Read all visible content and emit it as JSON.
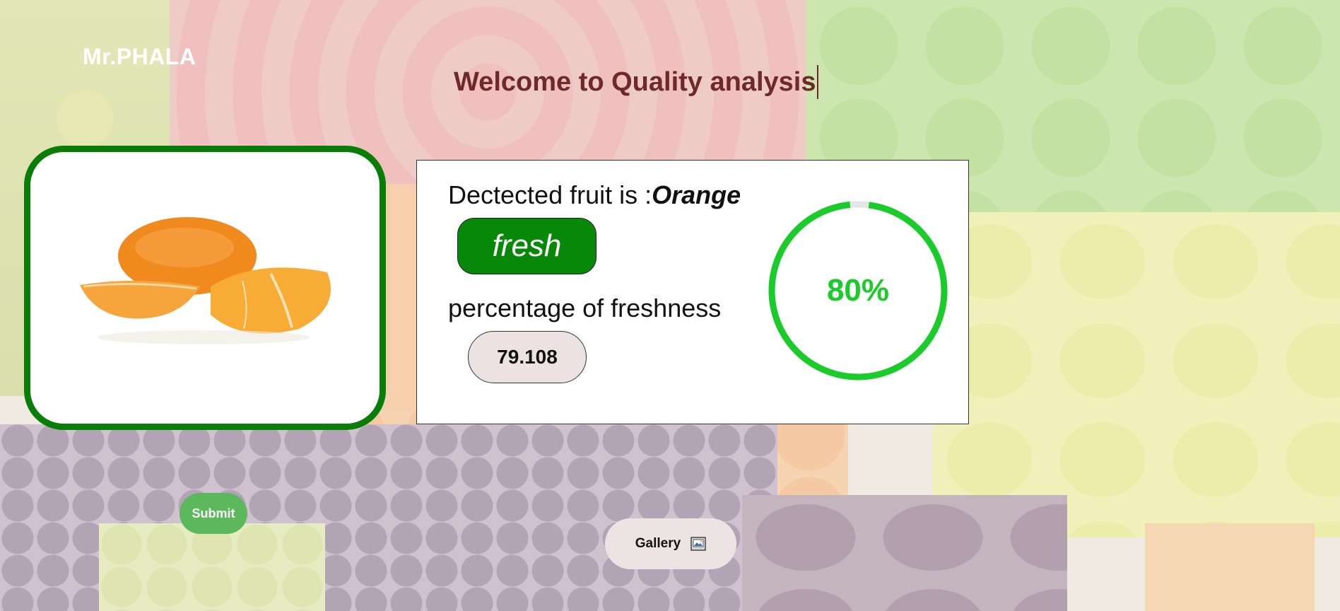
{
  "brand": "Mr.PHALA",
  "welcome": "Welcome to Quality analysis",
  "result": {
    "fruit_prefix": "Dectected fruit is :",
    "fruit_name": "Orange",
    "status": "fresh",
    "percentage_label": "percentage of freshness",
    "percentage_value": "79.108",
    "gauge_text": "80%",
    "gauge_fraction": 0.8
  },
  "buttons": {
    "submit": "Submit",
    "gallery": "Gallery"
  },
  "icons": [
    "gallery-icon"
  ],
  "colors": {
    "accent_green": "#087d08",
    "status_green": "#088808",
    "gauge_green": "#19cc29",
    "title_maroon": "#6e2a2a",
    "submit_green": "#5cb85c"
  }
}
